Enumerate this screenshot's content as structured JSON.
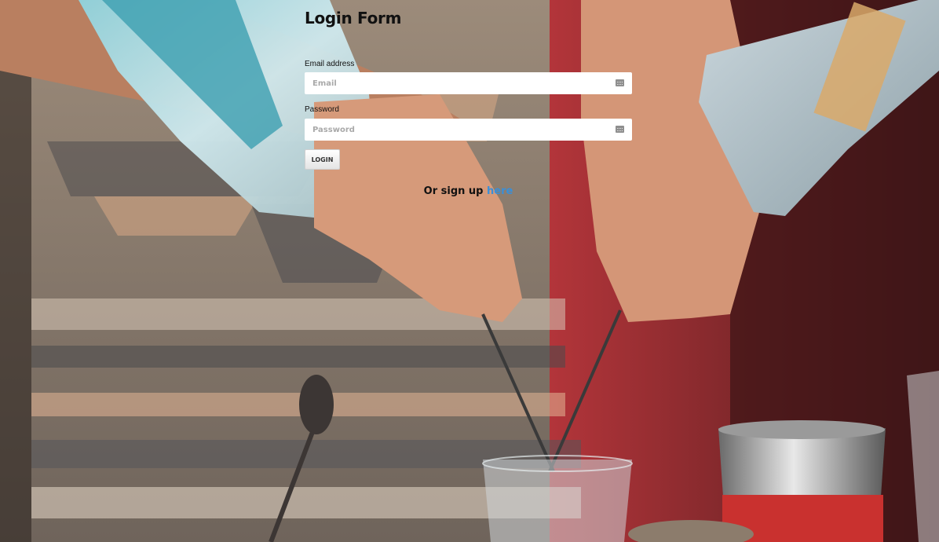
{
  "form": {
    "title": "Login Form",
    "email": {
      "label": "Email address",
      "placeholder": "Email",
      "value": ""
    },
    "password": {
      "label": "Password",
      "placeholder": "Password",
      "value": ""
    },
    "login_label": "LOGIN",
    "signup_text": "Or sign up",
    "signup_link": "here"
  },
  "icons": {
    "email_field_icon": "password-manager-icon",
    "password_field_icon": "password-manager-icon"
  },
  "colors": {
    "link": "#3a8fd8",
    "title": "#111111"
  }
}
